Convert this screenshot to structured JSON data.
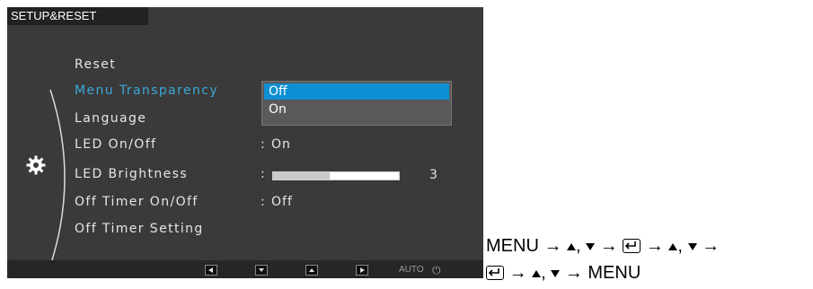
{
  "osd": {
    "title": "SETUP&RESET",
    "menu": [
      {
        "label": "Reset"
      },
      {
        "label": "Menu Transparency",
        "active": true
      },
      {
        "label": "Language"
      },
      {
        "label": "LED On/Off",
        "value": "On"
      },
      {
        "label": "LED Brightness",
        "value": "3",
        "level": 0.45
      },
      {
        "label": "Off Timer On/Off",
        "value": "Off"
      },
      {
        "label": "Off Timer Setting"
      }
    ],
    "dropdown": {
      "options": [
        "Off",
        "On"
      ],
      "selected": "Off"
    },
    "footer": {
      "auto_label": "AUTO",
      "power_glyph": "⏻"
    },
    "colors": {
      "panel": "#3a3a3a",
      "highlight": "#0e8fd3",
      "active_text": "#3aa8d8"
    }
  },
  "instructions": {
    "line1": {
      "menu": "MENU",
      "arrow": "→",
      "sep": ","
    },
    "line2": {
      "end": "MENU",
      "arrow": "→",
      "sep": ","
    }
  }
}
